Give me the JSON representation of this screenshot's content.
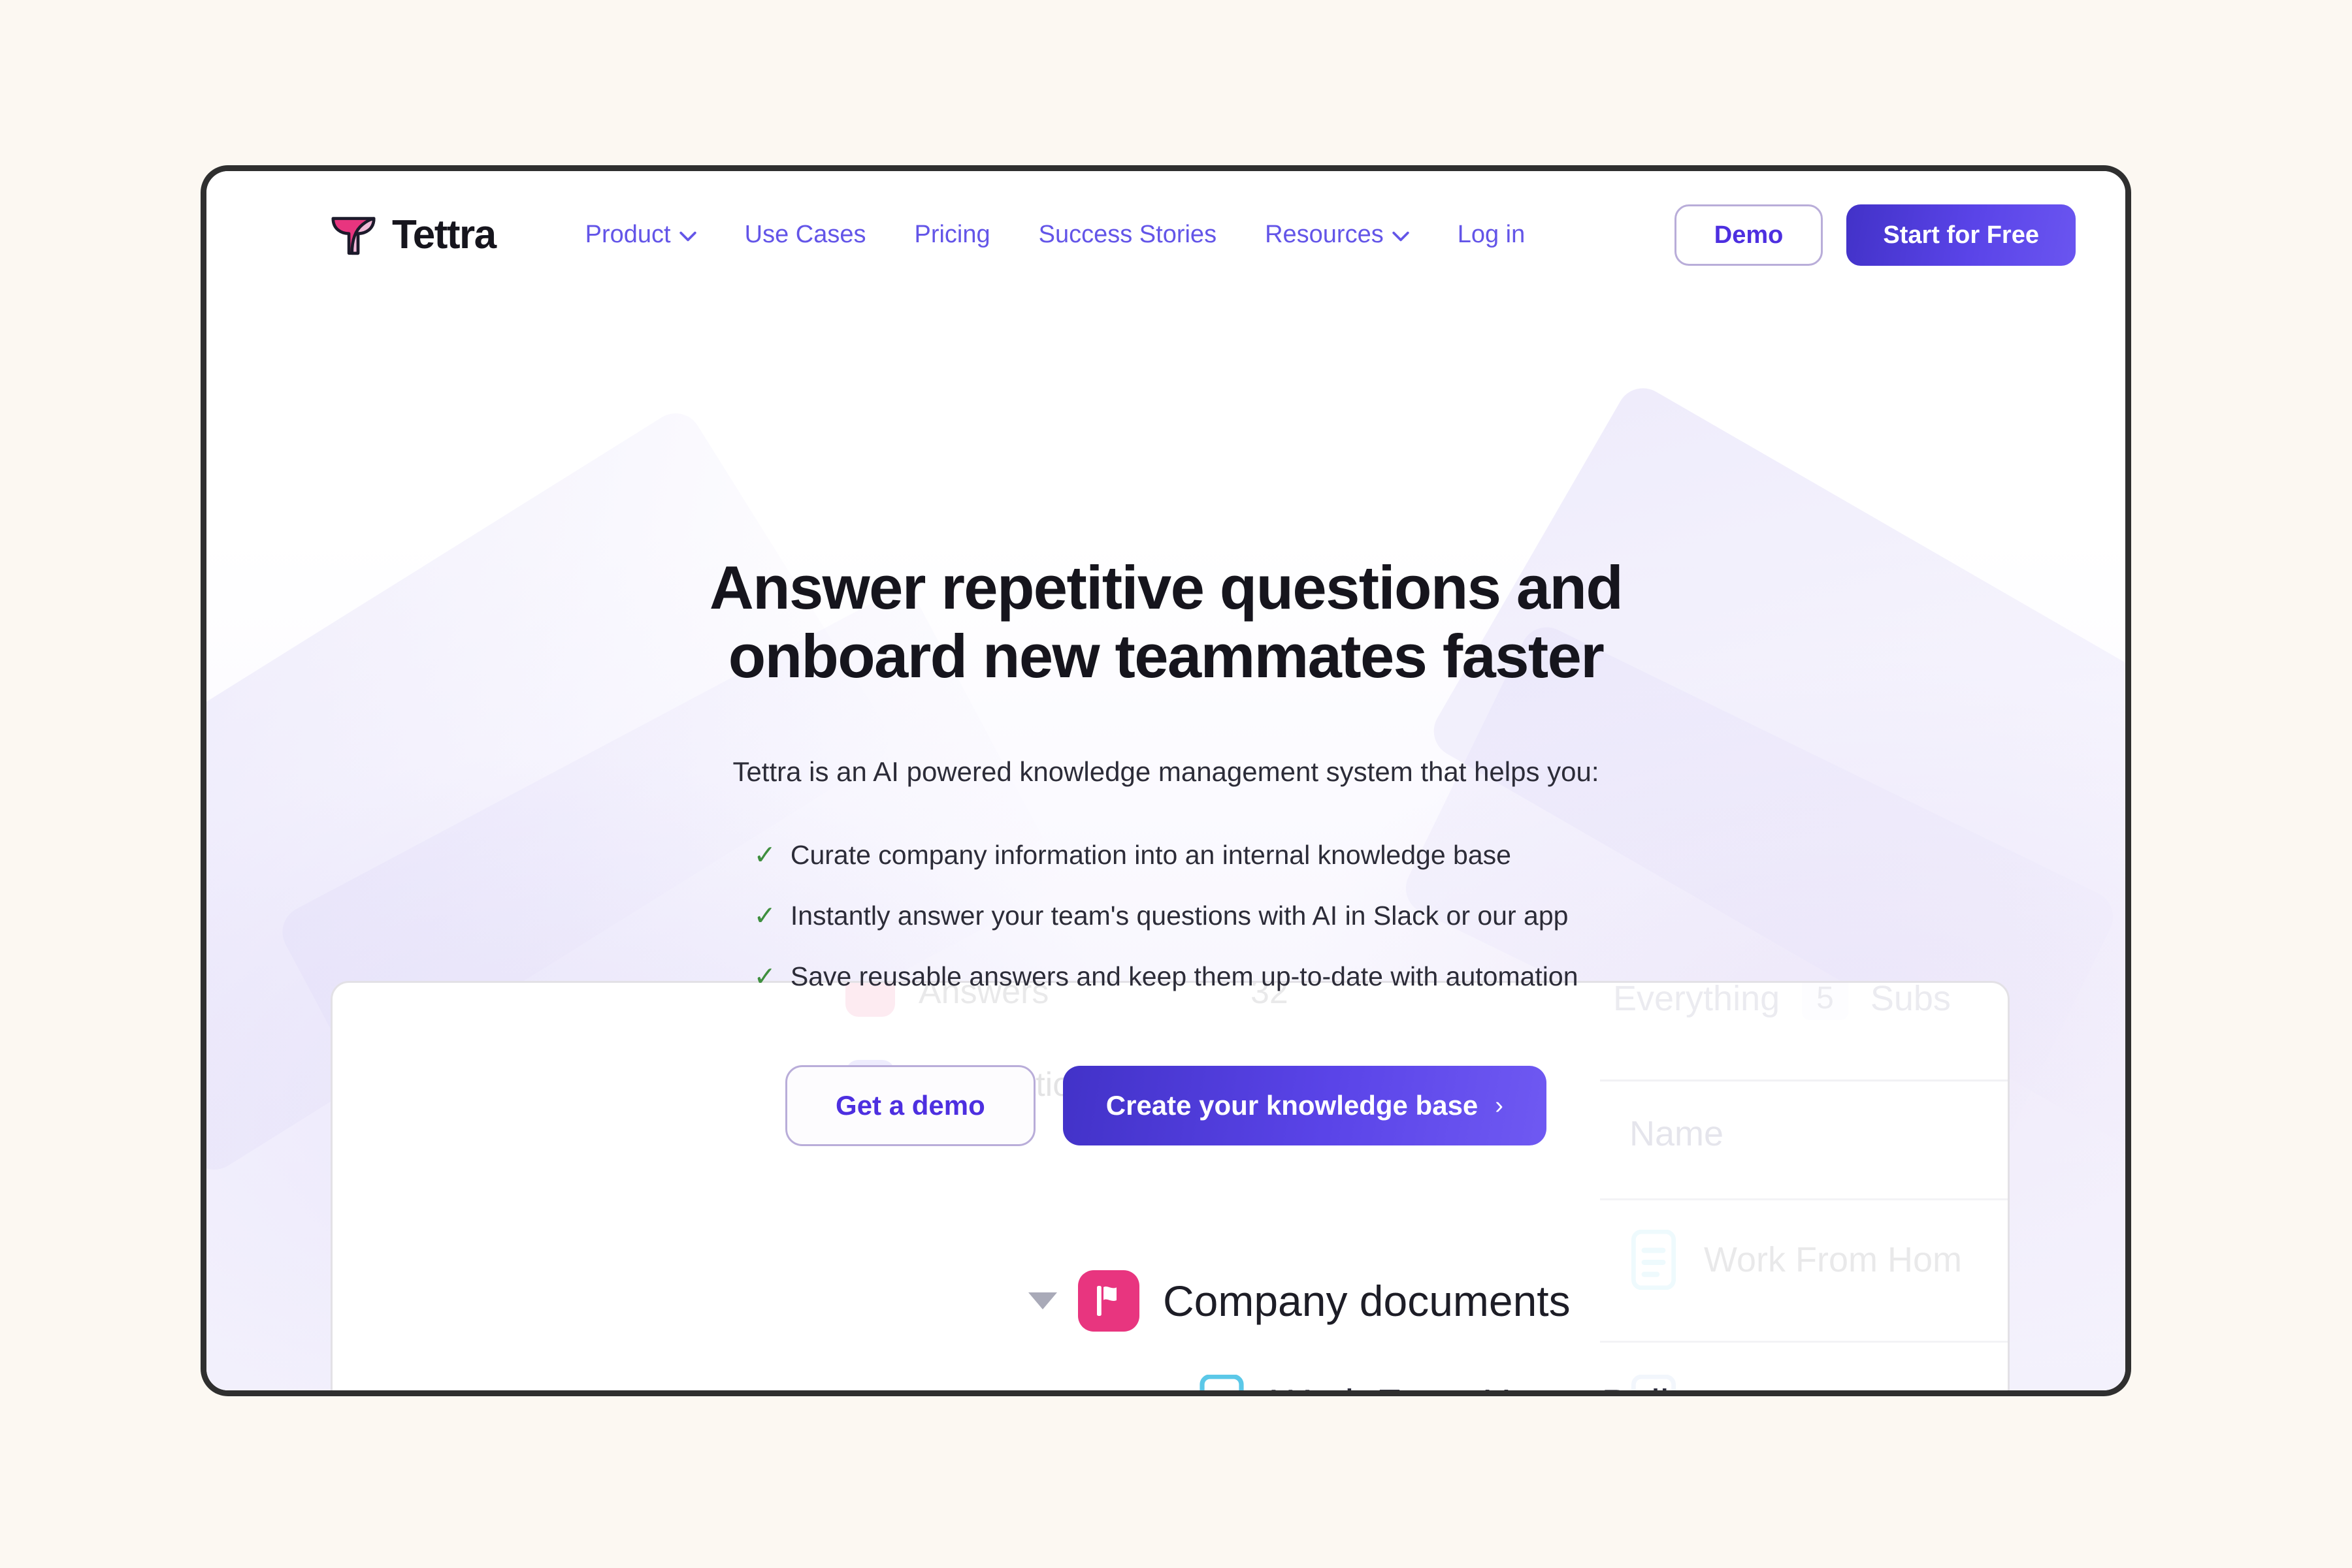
{
  "brand": {
    "name": "Tettra",
    "logo_icon": "tettra-whale-tail-logo",
    "logo_colors": {
      "dark": "#1c1a2b",
      "pink": "#e8357f",
      "light_pink": "#f0b4d4"
    }
  },
  "nav": {
    "links": [
      {
        "label": "Product",
        "has_chevron": true
      },
      {
        "label": "Use Cases",
        "has_chevron": false
      },
      {
        "label": "Pricing",
        "has_chevron": false
      },
      {
        "label": "Success Stories",
        "has_chevron": false
      },
      {
        "label": "Resources",
        "has_chevron": true
      },
      {
        "label": "Log in",
        "has_chevron": false
      }
    ],
    "link_color": "#6355e8",
    "demo_button": "Demo",
    "start_button": "Start for Free"
  },
  "hero": {
    "headline_line1": "Answer repetitive questions and",
    "headline_line2": "onboard new teammates faster",
    "subheading": "Tettra is an AI powered knowledge management system that helps you:",
    "check_mark": "✓",
    "check_color": "#3f8f3f",
    "bullets": [
      "Curate company information into an internal knowledge base",
      "Instantly answer your team's questions with AI in Slack or our app",
      "Save reusable answers and keep them up-to-date with automation"
    ],
    "cta_secondary": "Get a demo",
    "cta_primary": "Create your knowledge base",
    "cta_primary_arrow": "›"
  },
  "preview": {
    "sidebar_rows": [
      {
        "label": "Answers",
        "count": "32",
        "icon": "answers-icon",
        "icon_color": "#ec3f78"
      },
      {
        "label": "Automation",
        "count": "",
        "icon": "automation-sparkle-icon",
        "icon_color": "#7a6bf0"
      }
    ],
    "tabs": [
      {
        "label": "Everything",
        "badge": "5"
      },
      {
        "label": "Subs",
        "badge": ""
      }
    ],
    "column_header": "Name",
    "file_rows": [
      {
        "label": "Work From Hom",
        "icon": "document-icon"
      },
      {
        "label": "Roles & Expecta",
        "icon": "document-icon"
      }
    ],
    "tree": {
      "folder_label": "Company documents",
      "folder_icon": "pink-flag-folder-icon",
      "folder_color": "#e8357f",
      "doc_label": "Work From Home Policy",
      "doc_icon": "cyan-document-icon",
      "doc_color": "#5bc8e8",
      "toggle_icon": "triangle-down-icon"
    },
    "sound_button_icon": "speaker-volume-icon"
  },
  "colors": {
    "page_background": "#fcf8f2",
    "frame_border": "#2f2f2f",
    "accent_purple": "#4d2fe0",
    "accent_pink": "#e8357f",
    "heading_dark": "#16151d"
  }
}
